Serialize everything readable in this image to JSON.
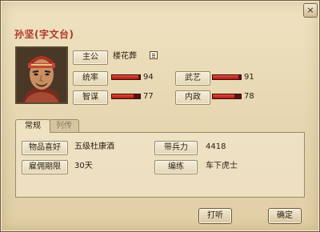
{
  "window": {
    "title": "孙坚(字文台)",
    "close_label": "×"
  },
  "character": {
    "faction_label": "主公",
    "faction_value": "楼花葬",
    "stats": [
      {
        "key": "command",
        "label": "统率",
        "value": "94",
        "level": 0.94
      },
      {
        "key": "martial",
        "label": "武艺",
        "value": "91",
        "level": 0.91
      },
      {
        "key": "intellect",
        "label": "智谋",
        "value": "77",
        "level": 0.77
      },
      {
        "key": "politics",
        "label": "内政",
        "value": "78",
        "level": 0.78
      }
    ],
    "icons": {
      "detail": "book-icon"
    },
    "colors": {
      "title": "#b0382a",
      "bar_fill": "#d0342a",
      "bar_track": "#5b1414"
    }
  },
  "tabs": [
    {
      "label": "常规",
      "active": true
    },
    {
      "label": "列传",
      "active": false
    }
  ],
  "details": {
    "hobby_label": "物品喜好",
    "hobby_value": "五级杜康酒",
    "troops_label": "带兵力",
    "troops_value": "4418",
    "hire_label": "雇佣期限",
    "hire_value": "30天",
    "training_label": "编练",
    "training_value": "车下虎士"
  },
  "buttons": {
    "dismiss_label": "打听",
    "confirm_label": "确定"
  }
}
